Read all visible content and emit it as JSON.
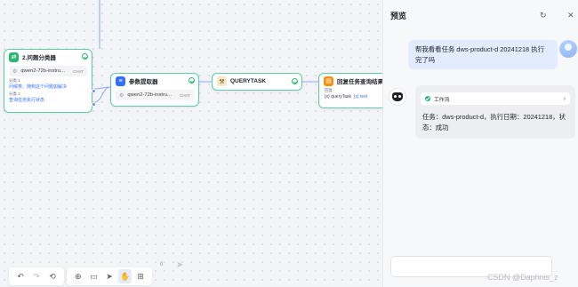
{
  "nodes": {
    "classifier": {
      "title": "2.问题分类器",
      "model": "qwen2-72b-instru...",
      "model_tag": "CHAT",
      "classes": [
        {
          "label": "分类 1",
          "text": "问候类、随到这个问题如解决"
        },
        {
          "label": "分类 2",
          "text": "查询任务执行状态"
        }
      ]
    },
    "param_extractor": {
      "title": "参数提取器",
      "model": "qwen2-72b-instru...",
      "model_tag": "CHAT"
    },
    "query_task": {
      "title": "QUERYTASK"
    },
    "reply": {
      "title": "回复任务查询结果",
      "label": "回复",
      "var_name": "queryTask",
      "var_type": "text"
    }
  },
  "toolbar_left": {
    "icons": [
      "undo-icon",
      "redo-icon",
      "history-icon"
    ]
  },
  "toolbar_right": {
    "icons": [
      "add-node-icon",
      "note-icon",
      "pointer-icon",
      "hand-icon",
      "layout-icon"
    ]
  },
  "preview": {
    "title": "预览",
    "user_message": "帮我看看任务 dws-product-d 20241218 执行完了吗",
    "workflow_label": "工作流",
    "bot_message": "任务：dws-product-d，执行日期：20241218，状态：成功",
    "input_count": "0"
  },
  "watermark": "CSDN @Daphnis_z",
  "colors": {
    "accent": "#3370ff",
    "success": "#2bb673",
    "node_border": "#5cd0a0"
  }
}
